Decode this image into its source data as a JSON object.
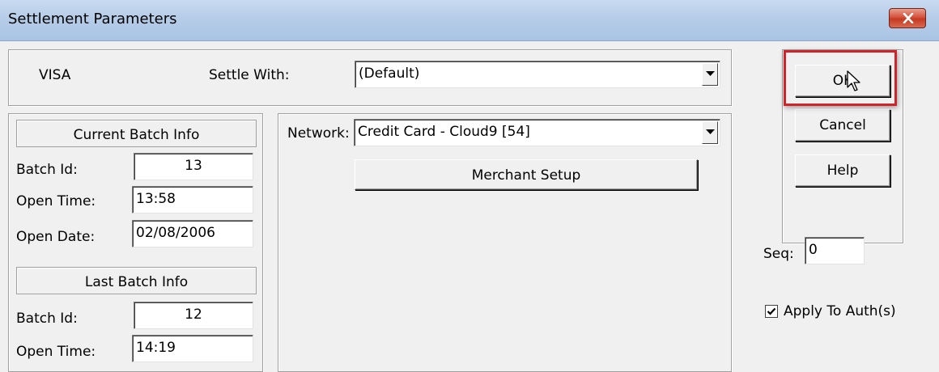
{
  "window": {
    "title": "Settlement Parameters",
    "close_icon": "close-icon"
  },
  "card": {
    "type_label": "VISA",
    "settle_with_label": "Settle With:",
    "settle_with_value": "(Default)"
  },
  "current_batch": {
    "heading": "Current Batch Info",
    "batch_id_label": "Batch Id:",
    "batch_id_value": "13",
    "open_time_label": "Open Time:",
    "open_time_value": "13:58",
    "open_date_label": "Open Date:",
    "open_date_value": "02/08/2006"
  },
  "last_batch": {
    "heading": "Last Batch Info",
    "batch_id_label": "Batch Id:",
    "batch_id_value": "12",
    "open_time_label": "Open Time:",
    "open_time_value": "14:19"
  },
  "network": {
    "label": "Network:",
    "value": "Credit Card - Cloud9  [54]",
    "merchant_setup_label": "Merchant Setup"
  },
  "buttons": {
    "ok": "OK",
    "cancel": "Cancel",
    "help": "Help"
  },
  "seq": {
    "label": "Seq:",
    "value": "0"
  },
  "apply_to_auth": {
    "label": "Apply To Auth(s)",
    "checked": true
  },
  "colors": {
    "highlight": "#d2232a",
    "titlebar": "#b6cde8",
    "close_button": "#c43a22"
  }
}
